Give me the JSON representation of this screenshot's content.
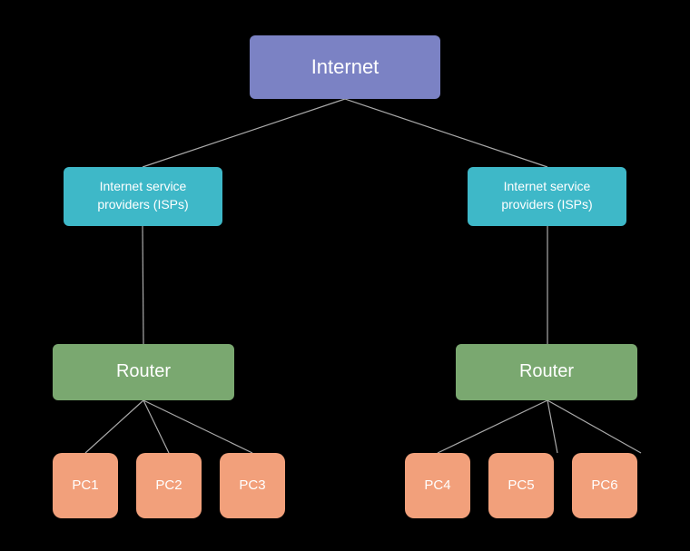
{
  "nodes": {
    "internet": {
      "label": "Internet"
    },
    "isp_left": {
      "label": "Internet service\nproviders (ISPs)"
    },
    "isp_right": {
      "label": "Internet service\nproviders (ISPs)"
    },
    "router_left": {
      "label": "Router"
    },
    "router_right": {
      "label": "Router"
    },
    "pc1": {
      "label": "PC1"
    },
    "pc2": {
      "label": "PC2"
    },
    "pc3": {
      "label": "PC3"
    },
    "pc4": {
      "label": "PC4"
    },
    "pc5": {
      "label": "PC5"
    },
    "pc6": {
      "label": "PC6"
    }
  },
  "colors": {
    "internet": "#7b82c4",
    "isp": "#3eb8c8",
    "router": "#7aa870",
    "pc": "#f2a07b",
    "line": "#aaaaaa",
    "bg": "#000000"
  }
}
